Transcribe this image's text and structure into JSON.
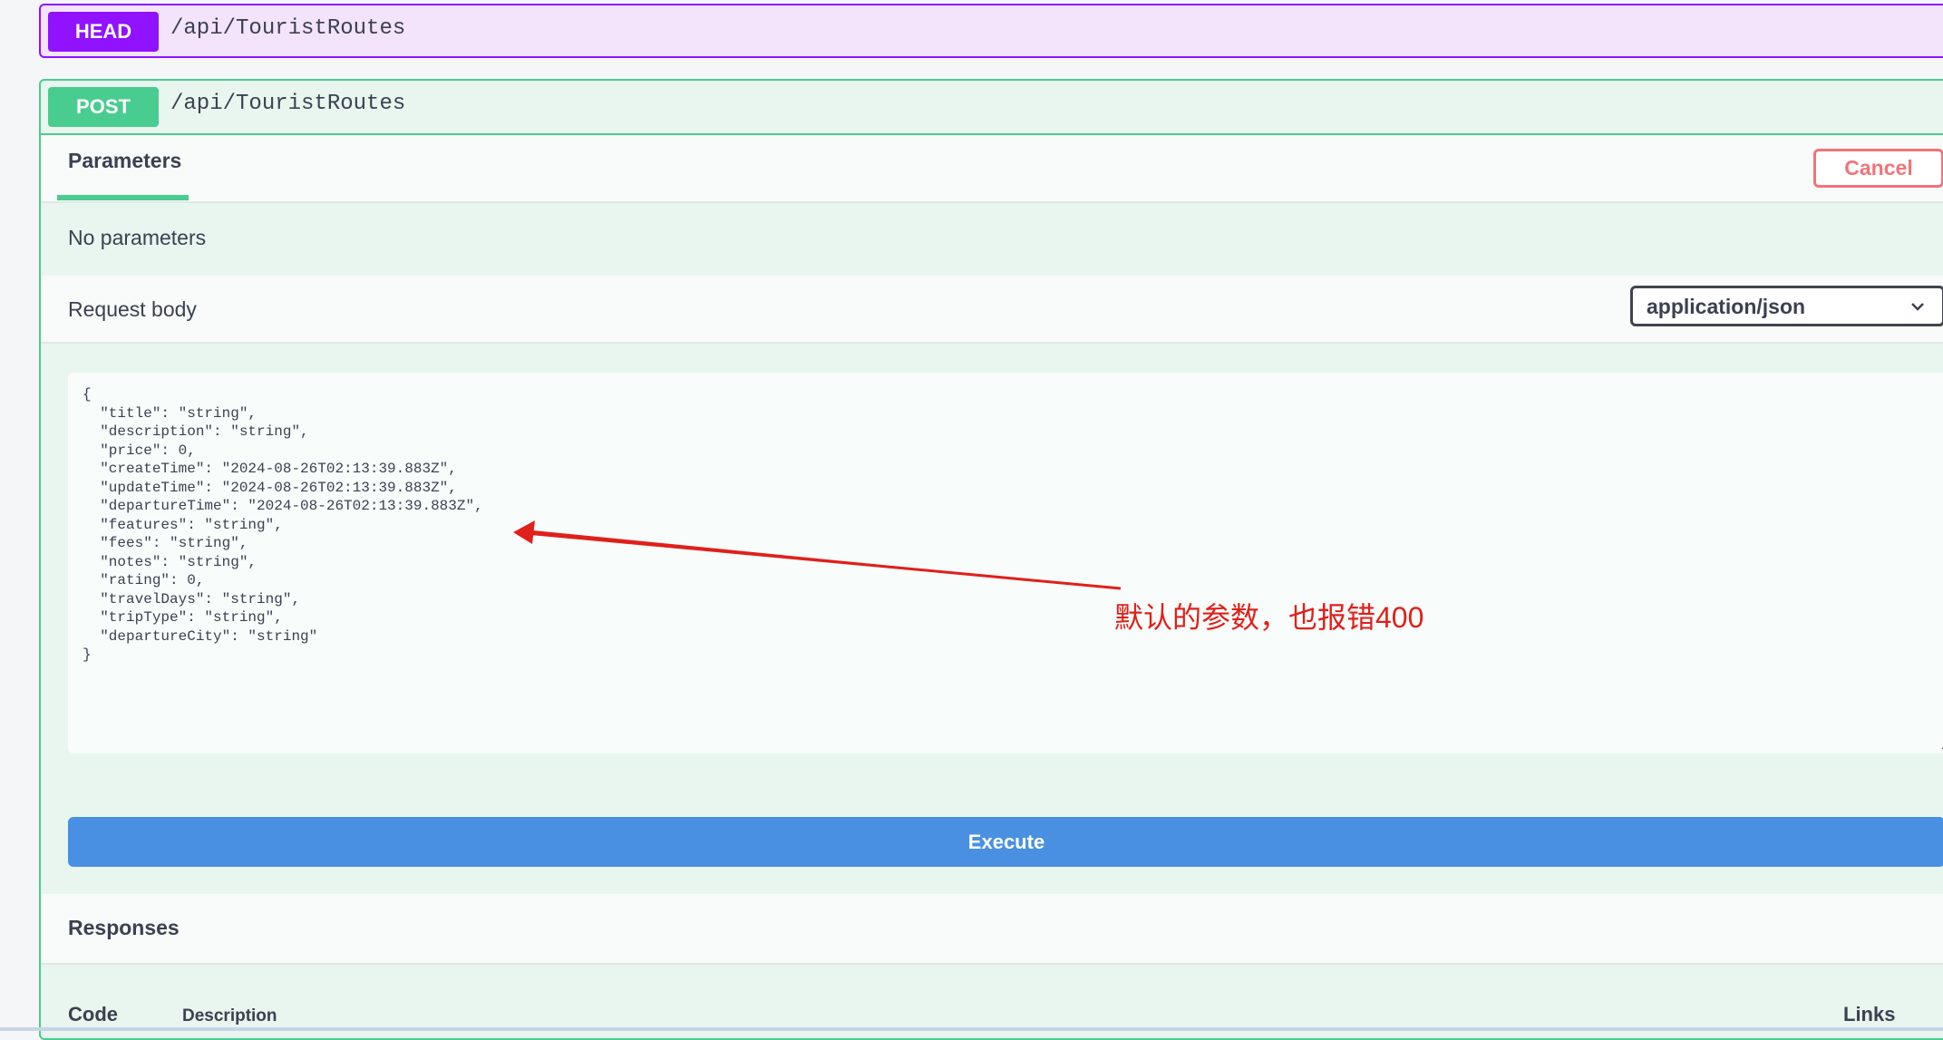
{
  "head_operation": {
    "method": "HEAD",
    "path": "/api/TouristRoutes"
  },
  "post_operation": {
    "method": "POST",
    "path": "/api/TouristRoutes",
    "tab_label": "Parameters",
    "cancel_label": "Cancel",
    "no_params_text": "No parameters",
    "request_body_label": "Request body",
    "content_type": "application/json",
    "request_body_json": "{\n  \"title\": \"string\",\n  \"description\": \"string\",\n  \"price\": 0,\n  \"createTime\": \"2024-08-26T02:13:39.883Z\",\n  \"updateTime\": \"2024-08-26T02:13:39.883Z\",\n  \"departureTime\": \"2024-08-26T02:13:39.883Z\",\n  \"features\": \"string\",\n  \"fees\": \"string\",\n  \"notes\": \"string\",\n  \"rating\": 0,\n  \"travelDays\": \"string\",\n  \"tripType\": \"string\",\n  \"departureCity\": \"string\"\n}",
    "execute_label": "Execute",
    "responses_label": "Responses",
    "table_headers": {
      "code": "Code",
      "description": "Description",
      "links": "Links"
    }
  },
  "annotation": {
    "text": "默认的参数，也报错400",
    "color": "#e0201a"
  },
  "colors": {
    "head": "#9012fe",
    "post": "#49cc90",
    "execute": "#4990e2",
    "cancel": "#f0747a"
  },
  "icons": {
    "dropdown": "chevron-down-icon",
    "resize": "resize-grip-icon"
  }
}
